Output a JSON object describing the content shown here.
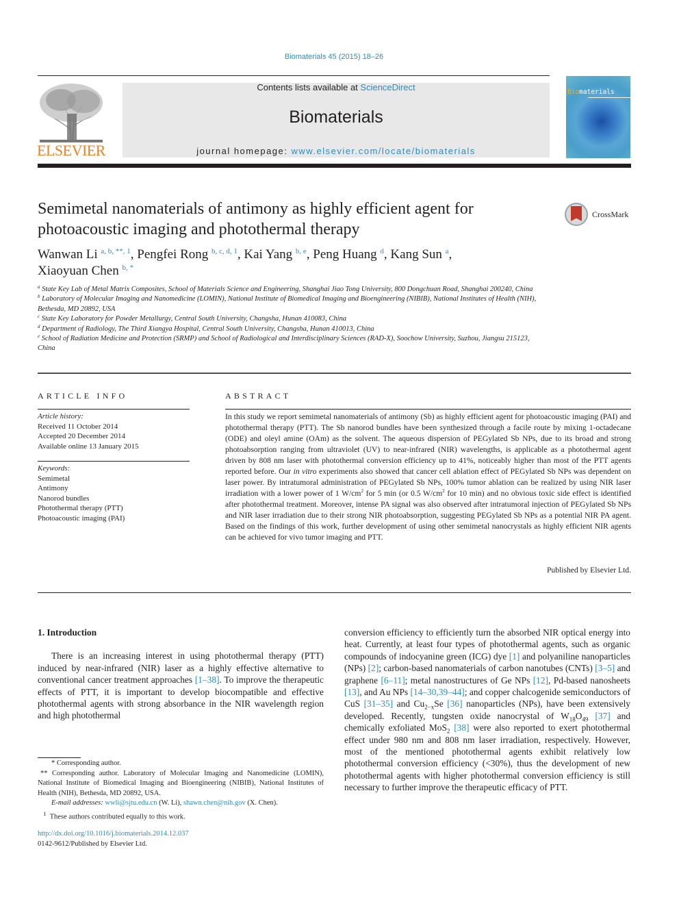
{
  "header": {
    "journal_ref": "Biomaterials 45 (2015) 18–26",
    "contents_prefix": "Contents lists available at ",
    "contents_link": "ScienceDirect",
    "journal_title": "Biomaterials",
    "homepage_prefix": "journal homepage: ",
    "homepage_link": "www.elsevier.com/locate/biomaterials",
    "publisher_logo": "ELSEVIER",
    "cover_title_accent": "Bio",
    "cover_title_rest": "materials",
    "crossmark": "CrossMark"
  },
  "article": {
    "title": "Semimetal nanomaterials of antimony as highly efficient agent for photoacoustic imaging and photothermal therapy",
    "authors": [
      {
        "name": "Wanwan Li",
        "sup": "a, b, **, 1"
      },
      {
        "name": "Pengfei Rong",
        "sup": "b, c, d, 1"
      },
      {
        "name": "Kai Yang",
        "sup": "b, e"
      },
      {
        "name": "Peng Huang",
        "sup": "d"
      },
      {
        "name": "Kang Sun",
        "sup": "a"
      },
      {
        "name": "Xiaoyuan Chen",
        "sup": "b, *"
      }
    ],
    "affiliations": [
      {
        "key": "a",
        "text": "State Key Lab of Metal Matrix Composites, School of Materials Science and Engineering, Shanghai Jiao Tong University, 800 Dongchuan Road, Shanghai 200240, China"
      },
      {
        "key": "b",
        "text": "Laboratory of Molecular Imaging and Nanomedicine (LOMIN), National Institute of Biomedical Imaging and Bioengineering (NIBIB), National Institutes of Health (NIH), Bethesda, MD 20892, USA"
      },
      {
        "key": "c",
        "text": "State Key Laboratory for Powder Metallurgy, Central South University, Changsha, Hunan 410083, China"
      },
      {
        "key": "d",
        "text": "Department of Radiology, The Third Xiangya Hospital, Central South University, Changsha, Hunan 410013, China"
      },
      {
        "key": "e",
        "text": "School of Radiation Medicine and Protection (SRMP) and School of Radiological and Interdisciplinary Sciences (RAD-X), Soochow University, Suzhou, Jiangsu 215123, China"
      }
    ]
  },
  "article_info": {
    "heading": "ARTICLE INFO",
    "history_label": "Article history:",
    "history": [
      "Received 11 October 2014",
      "Accepted 20 December 2014",
      "Available online 13 January 2015"
    ],
    "keywords_label": "Keywords:",
    "keywords": [
      "Semimetal",
      "Antimony",
      "Nanorod bundles",
      "Photothermal therapy (PTT)",
      "Photoacoustic imaging (PAI)"
    ]
  },
  "abstract": {
    "heading": "ABSTRACT",
    "part1": "In this study we report semimetal nanomaterials of antimony (Sb) as highly efficient agent for photoacoustic imaging (PAI) and photothermal therapy (PTT). The Sb nanorod bundles have been synthesized through a facile route by mixing 1-octadecane (ODE) and oleyl amine (OAm) as the solvent. The aqueous dispersion of PEGylated Sb NPs, due to its broad and strong photoabsorption ranging from ultraviolet (UV) to near-infrared (NIR) wavelengths, is applicable as a photothermal agent driven by 808 nm laser with photothermal conversion efficiency up to 41%, noticeably higher than most of the PTT agents reported before. Our ",
    "italic": "in vitro",
    "part2": " experiments also showed that cancer cell ablation effect of PEGylated Sb NPs was dependent on laser power. By intratumoral administration of PEGylated Sb NPs, 100% tumor ablation can be realized by using NIR laser irradiation with a lower power of 1 W/cm",
    "sup1": "2",
    "part3": " for 5 min (or 0.5 W/cm",
    "sup2": "2",
    "part4": " for 10 min) and no obvious toxic side effect is identified after photothermal treatment. Moreover, intense PA signal was also observed after intratumoral injection of PEGylated Sb NPs and NIR laser irradiation due to their strong NIR photoabsorption, suggesting PEGylated Sb NPs as a potential NIR PA agent. Based on the findings of this work, further development of using other semimetal nanocrystals as highly efficient NIR agents can be achieved for vivo tumor imaging and PTT.",
    "published": "Published by Elsevier Ltd."
  },
  "intro": {
    "heading": "1.  Introduction",
    "left": {
      "t1": "There is an increasing interest in using photothermal therapy (PTT) induced by near-infrared (NIR) laser as a highly effective alternative to conventional cancer treatment approaches ",
      "r1": "[1–38]",
      "t2": ". To improve the therapeutic effects of PTT, it is important to develop biocompatible and effective photothermal agents with strong absorbance in the NIR wavelength region and high photothermal"
    },
    "right": {
      "t1": "conversion efficiency to efficiently turn the absorbed NIR optical energy into heat. Currently, at least four types of photothermal agents, such as organic compounds of indocyanine green (ICG) dye ",
      "r1": "[1]",
      "t2": " and polyaniline nanoparticles (NPs) ",
      "r2": "[2]",
      "t3": "; carbon-based nanomaterials of carbon nanotubes (CNTs) ",
      "r3": "[3–5]",
      "t4": " and graphene ",
      "r4": "[6–11]",
      "t5": "; metal nanostructures of Ge NPs ",
      "r5": "[12]",
      "t6": ", Pd-based nanosheets ",
      "r6": "[13]",
      "t7": ", and Au NPs ",
      "r7": "[14–30,39–44]",
      "t8": "; and copper chalcogenide semiconductors of CuS ",
      "r8": "[31–35]",
      "t9": " and Cu",
      "sub1": "2−x",
      "t10": "Se ",
      "r9": "[36]",
      "t11": " nanoparticles (NPs), have been extensively developed. Recently, tungsten oxide nanocrystal of W",
      "sub2": "18",
      "t12": "O",
      "sub3": "49",
      "t13": " ",
      "r10": "[37]",
      "t14": " and chemically exfoliated MoS",
      "sub4": "2",
      "t15": " ",
      "r11": "[38]",
      "t16": " were also reported to exert photothermal effect under 980 nm and 808 nm laser irradiation, respectively. However, most of the mentioned photothermal agents exhibit relatively low photothermal conversion efficiency (<30%), thus the development of new photothermal agents with higher photothermal conversion efficiency is still necessary to further improve the therapeutic efficacy of PTT."
    }
  },
  "footnotes": {
    "star1": "* Corresponding author.",
    "star2": "** Corresponding author. Laboratory of Molecular Imaging and Nanomedicine (LOMIN), National Institute of Biomedical Imaging and Bioengineering (NIBIB), National Institutes of Health (NIH), Bethesda, MD 20892, USA.",
    "email_label": "E-mail addresses:",
    "email1": "wwli@sjtu.edu.cn",
    "email1_who": " (W. Li), ",
    "email2": "shawn.chen@nih.gov",
    "email2_who": " (X. Chen).",
    "equal_sup": "1",
    "equal": "These authors contributed equally to this work.",
    "doi": "http://dx.doi.org/10.1016/j.biomaterials.2014.12.037",
    "issn": "0142-9612/Published by Elsevier Ltd."
  }
}
